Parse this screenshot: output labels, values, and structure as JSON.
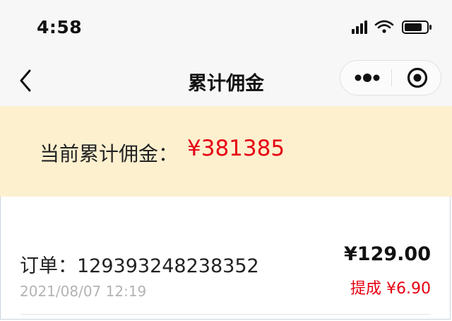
{
  "status_bar": {
    "time": "4:58"
  },
  "nav": {
    "title": "累计佣金"
  },
  "summary": {
    "label": "当前累计佣金：",
    "value": "¥381385"
  },
  "order": {
    "number": "订单：129393248238352",
    "time": "2021/08/07 12:19",
    "amount": "¥129.00",
    "commission": "提成 ¥6.90"
  },
  "colors": {
    "accent_red": "#e60012",
    "banner_bg": "#fcf0cf",
    "bar_bg": "#f7f7f7"
  },
  "icons": [
    "signal-icon",
    "wifi-icon",
    "battery-icon",
    "back-icon",
    "more-icon",
    "close-target-icon"
  ]
}
